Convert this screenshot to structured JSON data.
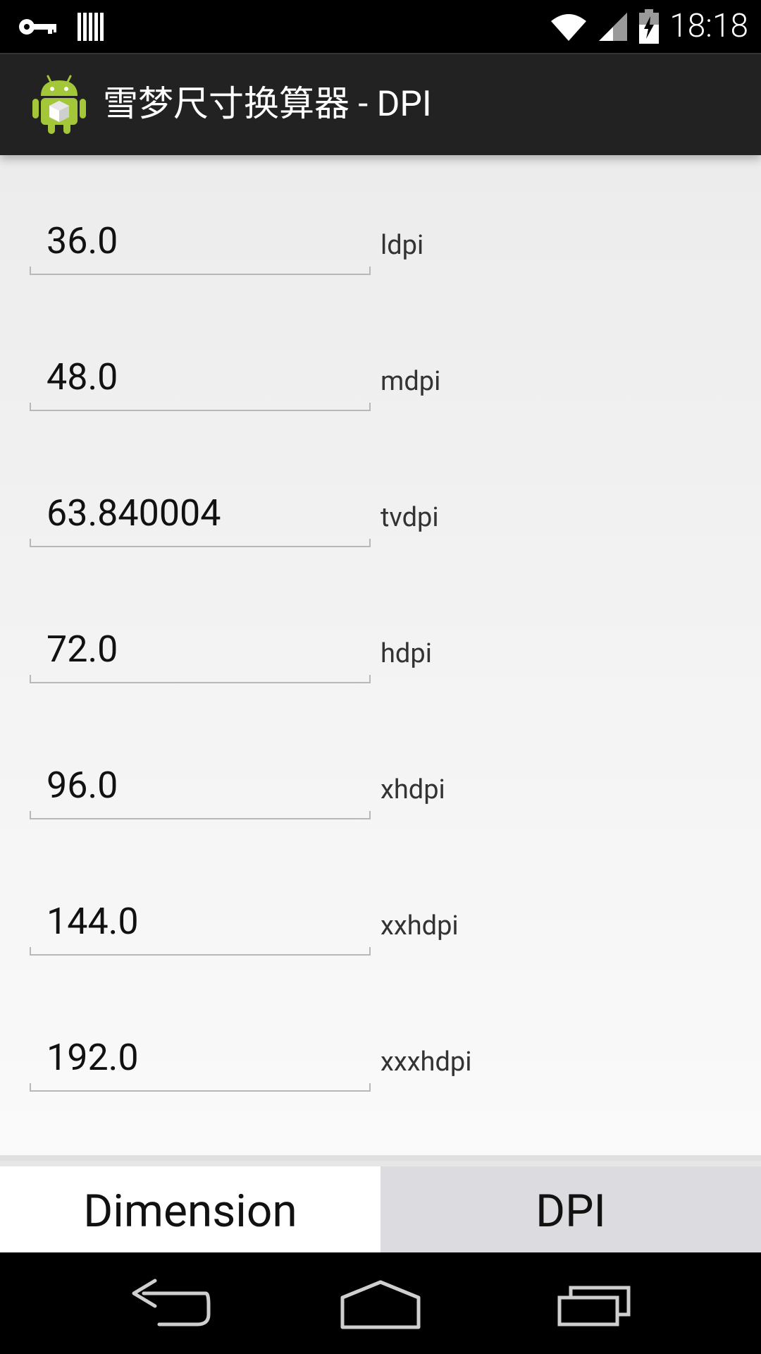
{
  "status_bar": {
    "time": "18:18",
    "left_icons": [
      "vpn-key-icon",
      "barcode-icon"
    ],
    "right_icons": [
      "wifi-icon",
      "signal-icon",
      "battery-charging-icon"
    ]
  },
  "action_bar": {
    "title": "雪梦尺寸换算器 - DPI"
  },
  "rows": [
    {
      "value": "36.0",
      "unit": "ldpi"
    },
    {
      "value": "48.0",
      "unit": "mdpi"
    },
    {
      "value": "63.840004",
      "unit": "tvdpi"
    },
    {
      "value": "72.0",
      "unit": "hdpi"
    },
    {
      "value": "96.0",
      "unit": "xhdpi"
    },
    {
      "value": "144.0",
      "unit": "xxhdpi"
    },
    {
      "value": "192.0",
      "unit": "xxxhdpi"
    }
  ],
  "tabs": {
    "dimension": "Dimension",
    "dpi": "DPI"
  },
  "colors": {
    "action_bar": "#222222",
    "content_bg": "#f3f3f3",
    "tab_active": "#ffffff",
    "tab_inactive": "#dcdbe0"
  }
}
